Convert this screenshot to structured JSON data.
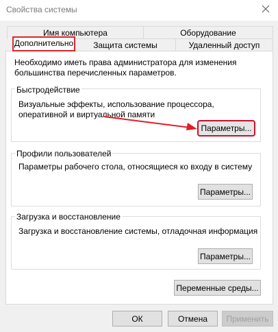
{
  "window": {
    "title": "Свойства системы",
    "close_icon": "close-icon"
  },
  "tabs": {
    "row1": [
      {
        "label": "Имя компьютера"
      },
      {
        "label": "Оборудование"
      }
    ],
    "row2": [
      {
        "label": "Дополнительно",
        "active": true
      },
      {
        "label": "Защита системы"
      },
      {
        "label": "Удаленный доступ"
      }
    ]
  },
  "panel": {
    "intro": "Необходимо иметь права администратора для изменения большинства перечисленных параметров.",
    "performance": {
      "title": "Быстродействие",
      "description": "Визуальные эффекты, использование процессора, оперативной и виртуальной памяти",
      "button": "Параметры..."
    },
    "profiles": {
      "title": "Профили пользователей",
      "description": "Параметры рабочего стола, относящиеся ко входу в систему",
      "button": "Параметры..."
    },
    "startup": {
      "title": "Загрузка и восстановление",
      "description": "Загрузка и восстановление системы, отладочная информация",
      "button": "Параметры..."
    },
    "env_button": "Переменные среды..."
  },
  "footer": {
    "ok": "ОК",
    "cancel": "Отмена",
    "apply": "Применить"
  },
  "colors": {
    "highlight": "#e0242c",
    "arrow": "#e31e24"
  }
}
